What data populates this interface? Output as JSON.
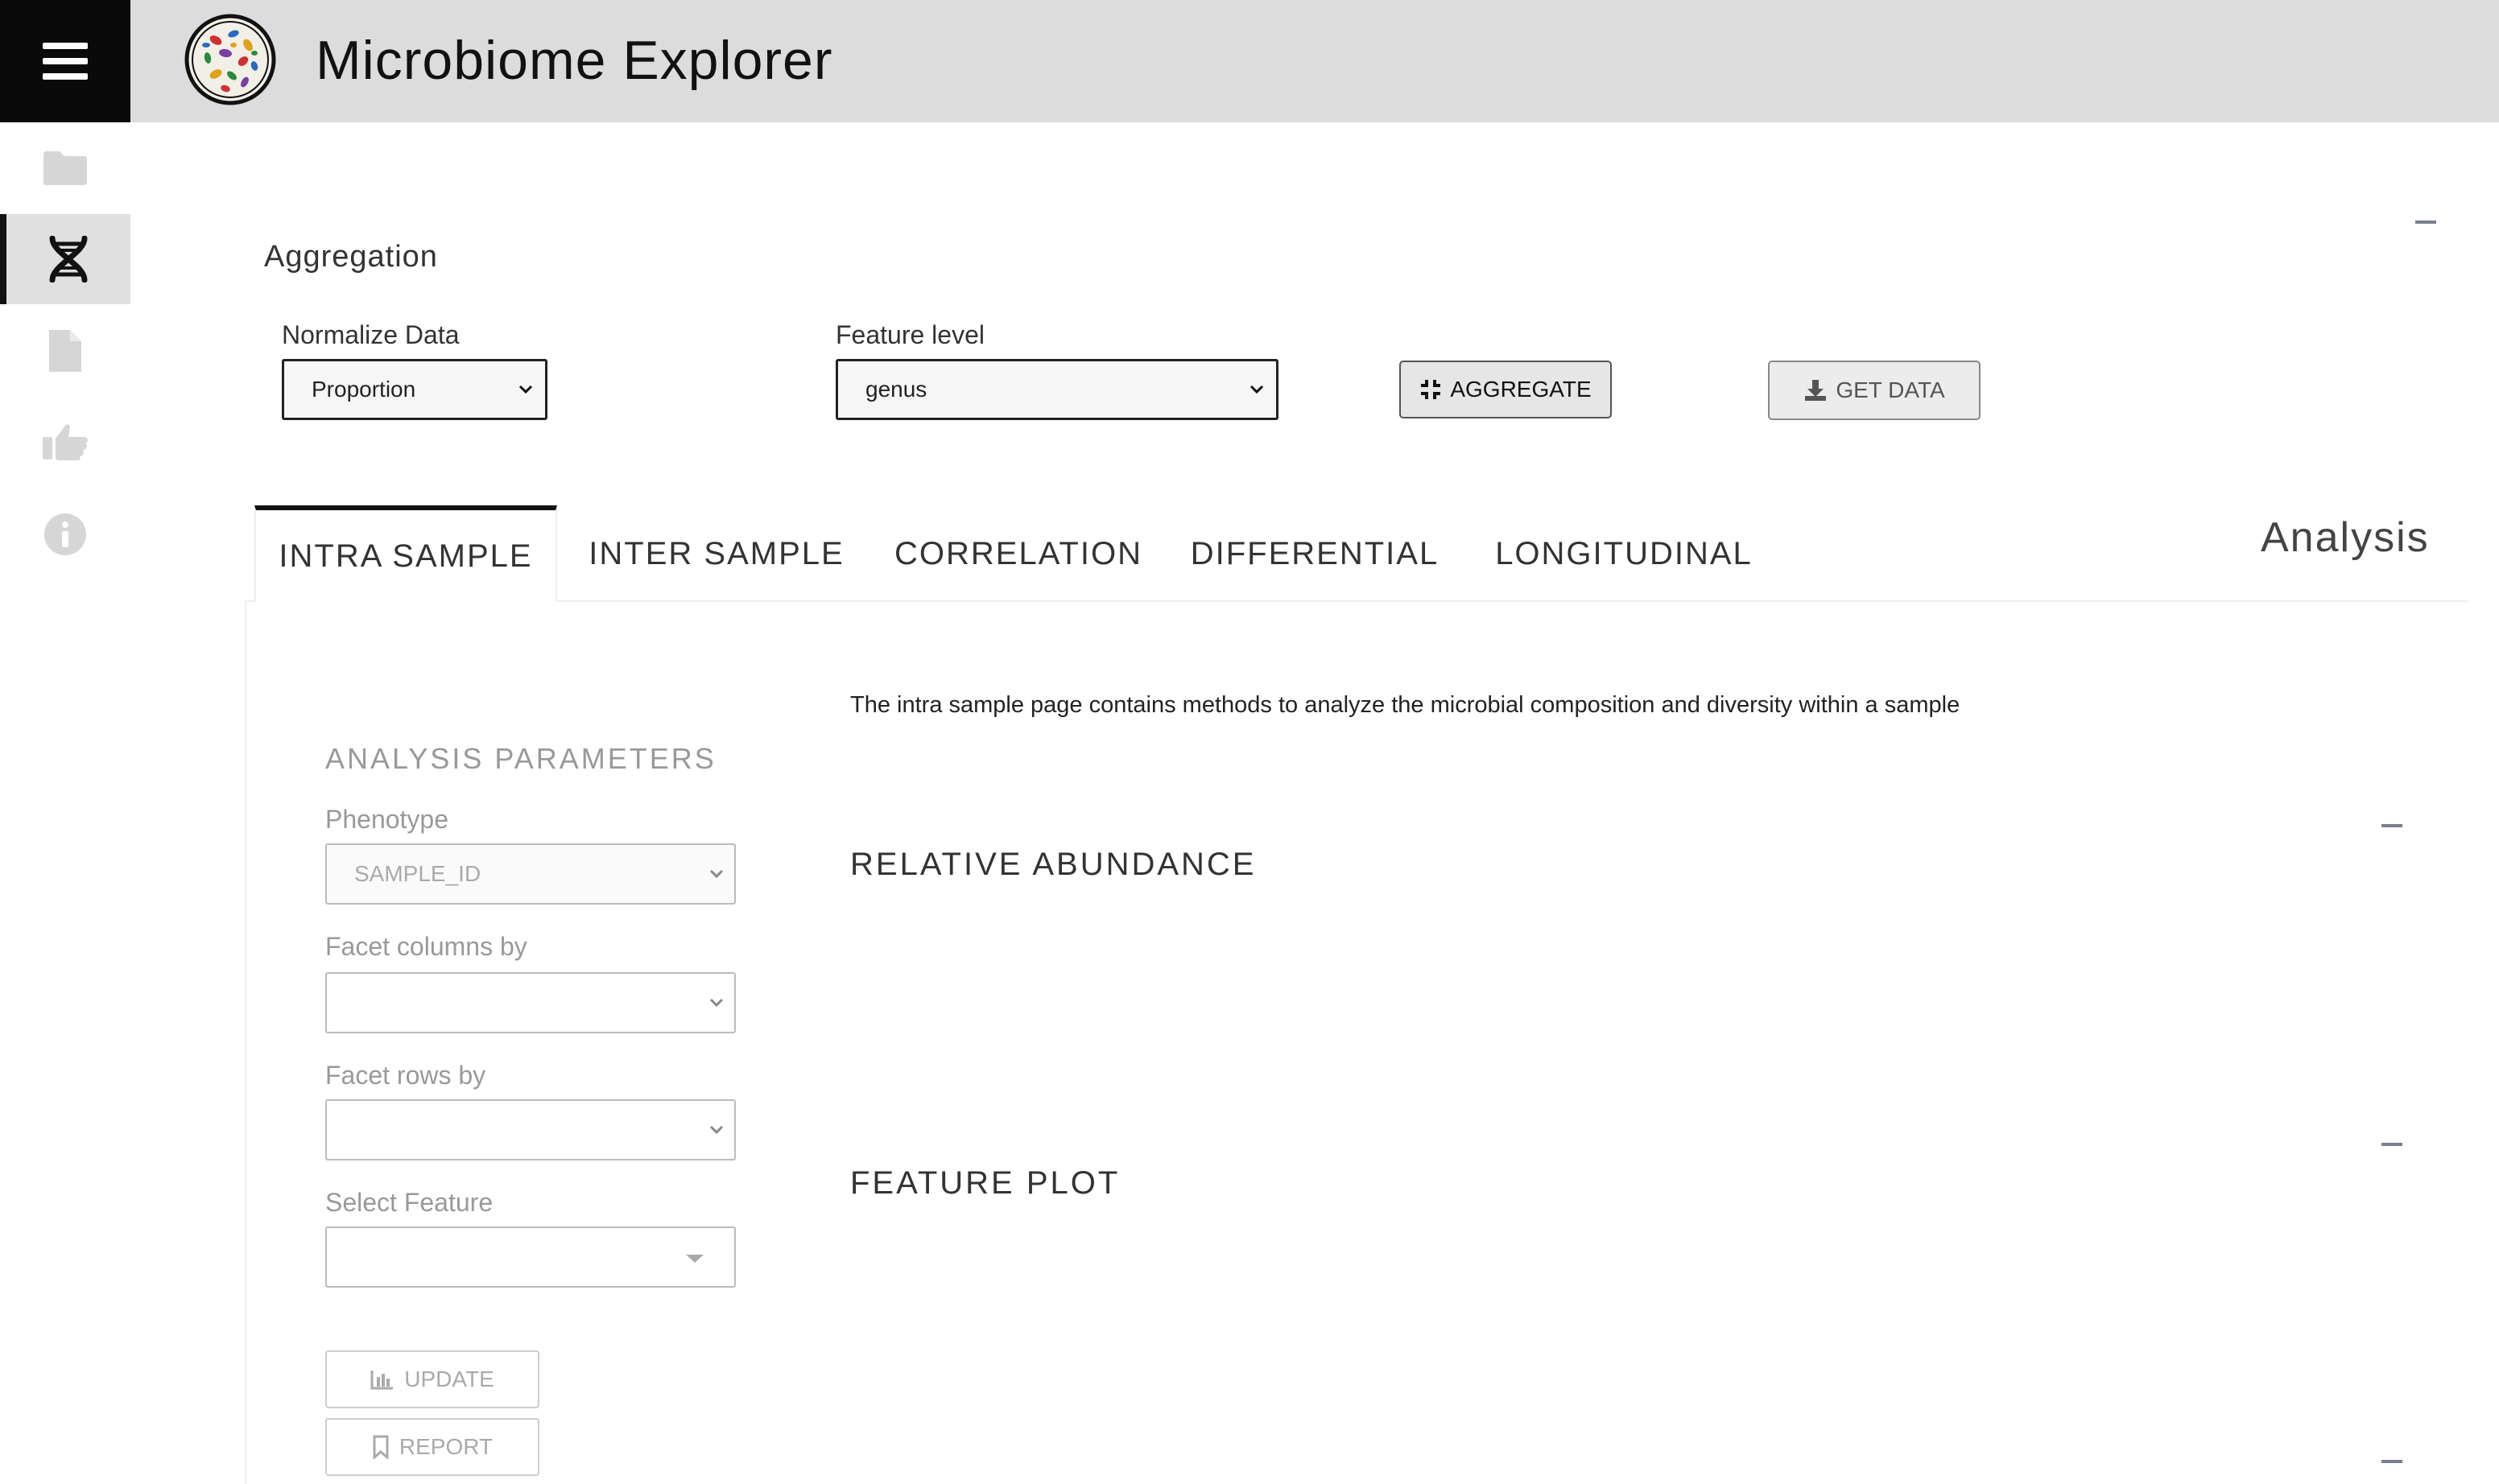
{
  "app": {
    "title": "Microbiome Explorer"
  },
  "sidebar": {
    "items": [
      {
        "icon": "folder-icon"
      },
      {
        "icon": "dna-icon",
        "active": true
      },
      {
        "icon": "document-icon"
      },
      {
        "icon": "thumbs-up-icon"
      },
      {
        "icon": "info-icon"
      }
    ]
  },
  "aggregation": {
    "title": "Aggregation",
    "normalize_label": "Normalize Data",
    "normalize_value": "Proportion",
    "feature_label": "Feature level",
    "feature_value": "genus",
    "aggregate_button": "AGGREGATE",
    "get_data_button": "GET DATA"
  },
  "tabs": [
    {
      "label": "INTRA SAMPLE",
      "active": true
    },
    {
      "label": "INTER SAMPLE"
    },
    {
      "label": "CORRELATION"
    },
    {
      "label": "DIFFERENTIAL"
    },
    {
      "label": "LONGITUDINAL"
    }
  ],
  "analysis_title": "Analysis",
  "params": {
    "title": "ANALYSIS PARAMETERS",
    "phenotype_label": "Phenotype",
    "phenotype_value": "SAMPLE_ID",
    "facet_columns_label": "Facet columns by",
    "facet_columns_value": "",
    "facet_rows_label": "Facet rows by",
    "facet_rows_value": "",
    "select_feature_label": "Select Feature",
    "select_feature_value": "",
    "update_button": "UPDATE",
    "report_button": "REPORT"
  },
  "content": {
    "description": "The intra sample page contains methods to analyze the microbial composition and diversity within a sample",
    "relative_abundance_title": "RELATIVE ABUNDANCE",
    "feature_plot_title": "FEATURE PLOT"
  },
  "colors": {
    "header_bg": "#dcdcdc",
    "hamburger_bg": "#0a0a0a",
    "sidebar_active_bg": "#e0e0e0",
    "sidebar_icon_inactive": "#cfcfcf",
    "collapse_dash": "#7a7f8f"
  }
}
